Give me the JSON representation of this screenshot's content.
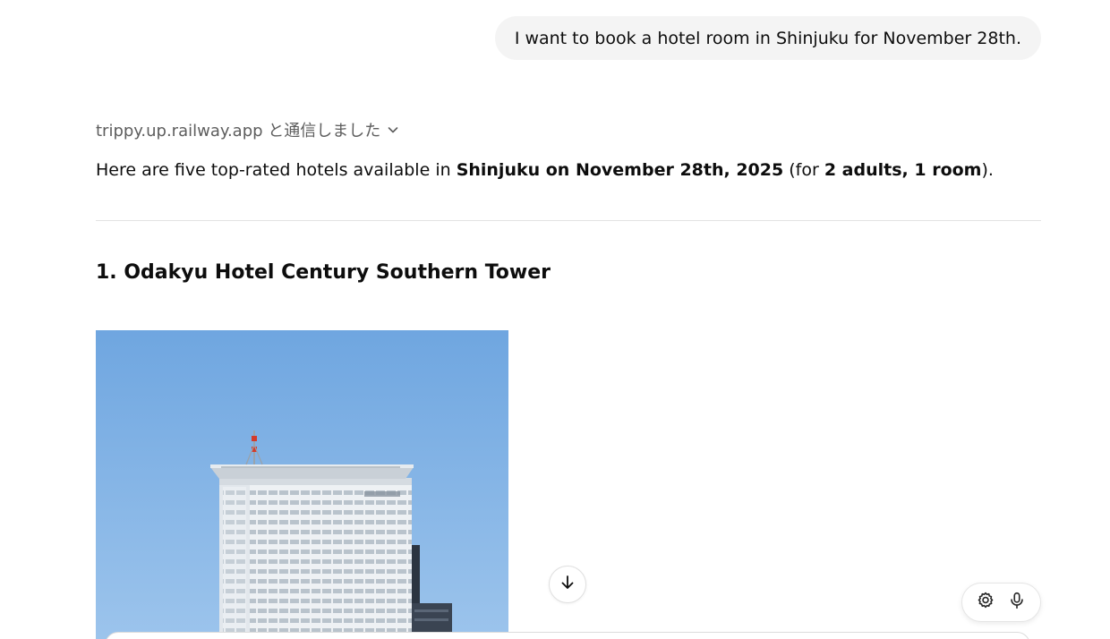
{
  "user_message": {
    "text": "I want to book a hotel room in Shinjuku for November 28th."
  },
  "tool_call": {
    "text": "trippy.up.railway.app と通信しました",
    "icon": "chevron-down-icon"
  },
  "assistant": {
    "intro_prefix": "Here are five top-rated hotels available in ",
    "intro_bold_location_date": "Shinjuku on November 28th, 2025",
    "intro_mid": " (for ",
    "intro_bold_guests": "2 adults, 1 room",
    "intro_suffix": ")."
  },
  "hotels": [
    {
      "title": "1. Odakyu Hotel Century Southern Tower",
      "image_alt": "hotel-tower-photo"
    }
  ],
  "controls": {
    "scroll_down_icon": "arrow-down-icon",
    "settings_icon": "gear-icon",
    "voice_icon": "microphone-icon"
  },
  "colors": {
    "user_bubble_bg": "#f4f4f4",
    "muted_text": "#5d5d5d",
    "sky_top": "#6fa6e0",
    "sky_bottom": "#9cc4ec",
    "divider": "#e3e3e3"
  }
}
